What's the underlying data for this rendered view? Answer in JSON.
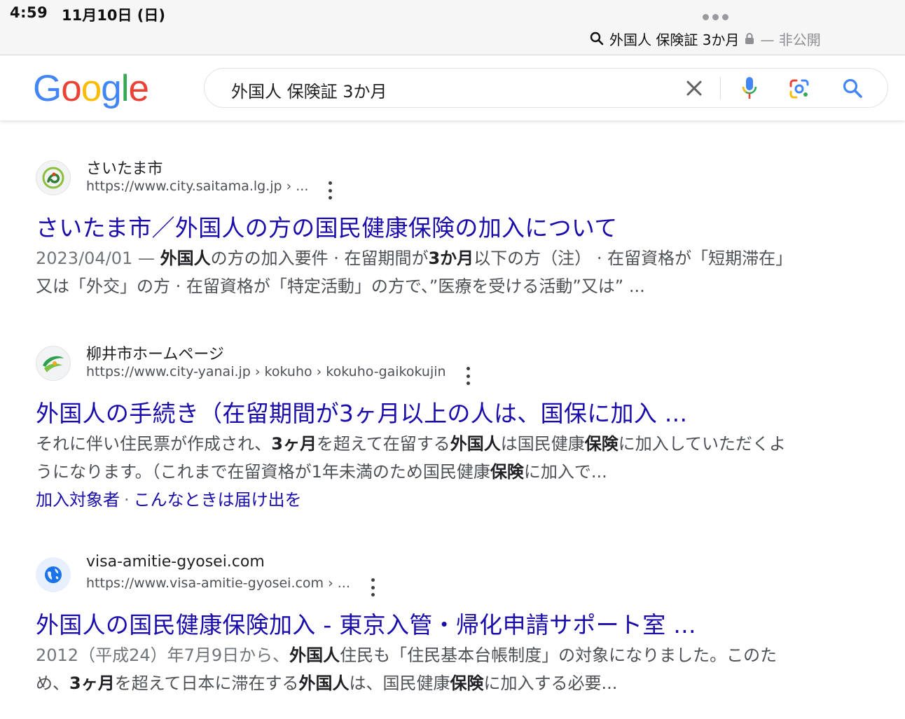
{
  "status_bar": {
    "time": "4:59",
    "date": "11月10日 (日)",
    "address": "外国人 保険証 3か月",
    "private_label": "— 非公開"
  },
  "header": {
    "logo_letters": [
      {
        "ch": "G",
        "color": "#4285F4"
      },
      {
        "ch": "o",
        "color": "#EA4335"
      },
      {
        "ch": "o",
        "color": "#FBBC05"
      },
      {
        "ch": "g",
        "color": "#4285F4"
      },
      {
        "ch": "l",
        "color": "#34A853"
      },
      {
        "ch": "e",
        "color": "#EA4335"
      }
    ],
    "query": "外国人 保険証 3か月"
  },
  "results": [
    {
      "site_name": "さいたま市",
      "url": "https://www.city.saitama.lg.jp › ...",
      "title": "さいたま市／外国人の方の国民健康保険の加入について",
      "snippet": [
        {
          "t": "2023/04/01 — ",
          "b": false
        },
        {
          "t": "外国人",
          "b": true
        },
        {
          "t": "の方の加入要件 · 在留期間が",
          "b": false
        },
        {
          "t": "3か月",
          "b": true
        },
        {
          "t": "以下の方（注） · 在留資格が「短期滞在」又は「外交」の方 · 在留資格が「特定活動」の方で、”医療を受ける活動”又は” ...",
          "b": false
        }
      ]
    },
    {
      "site_name": "柳井市ホームページ",
      "url": "https://www.city-yanai.jp › kokuho › kokuho-gaikokujin",
      "title": "外国人の手続き（在留期間が3ヶ月以上の人は、国保に加入 ...",
      "snippet": [
        {
          "t": "それに伴い住民票が作成され、",
          "b": false
        },
        {
          "t": "3ヶ月",
          "b": true
        },
        {
          "t": "を超えて在留する",
          "b": false
        },
        {
          "t": "外国人",
          "b": true
        },
        {
          "t": "は国民健康",
          "b": false
        },
        {
          "t": "保険",
          "b": true
        },
        {
          "t": "に加入していただくようになります。（これまで在留資格が1年未満のため国民健康",
          "b": false
        },
        {
          "t": "保険",
          "b": true
        },
        {
          "t": "に加入で...",
          "b": false
        }
      ],
      "sitelinks": [
        "加入対象者",
        "こんなときは届け出を"
      ]
    },
    {
      "site_name": "visa-amitie-gyosei.com",
      "url": "https://www.visa-amitie-gyosei.com › ...",
      "title": "外国人の国民健康保険加入 - 東京入管・帰化申請サポート室 ...",
      "snippet": [
        {
          "t": "2012（平成24）年7月9日から、",
          "b": false
        },
        {
          "t": "外国人",
          "b": true
        },
        {
          "t": "住民も「住民基本台帳制度」の対象になりました。このため、",
          "b": false
        },
        {
          "t": "3ヶ月",
          "b": true
        },
        {
          "t": "を超えて日本に滞在する",
          "b": false
        },
        {
          "t": "外国人",
          "b": true
        },
        {
          "t": "は、国民健康",
          "b": false
        },
        {
          "t": "保険",
          "b": true
        },
        {
          "t": "に加入する必要...",
          "b": false
        }
      ]
    }
  ]
}
